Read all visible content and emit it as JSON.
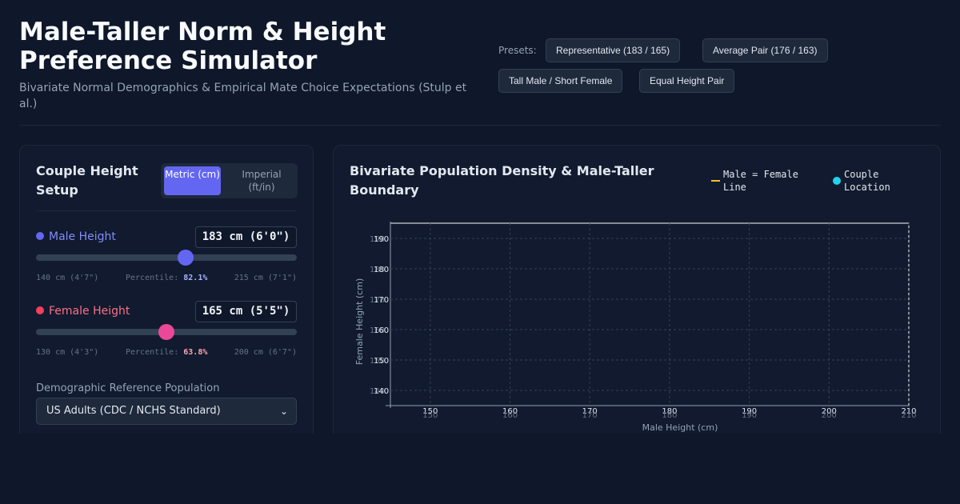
{
  "header": {
    "title": "Male-Taller Norm & Height Preference Simulator",
    "subtitle": "Bivariate Normal Demographics & Empirical Mate Choice Expectations (Stulp et al.)"
  },
  "presets": {
    "label": "Presets:",
    "items": [
      {
        "label": "Representative (183 / 165)"
      },
      {
        "label": "Average Pair (176 / 163)"
      },
      {
        "label": "Tall Male / Short Female"
      },
      {
        "label": "Equal Height Pair"
      }
    ]
  },
  "setup": {
    "title": "Couple Height Setup",
    "units": {
      "metric": "Metric (cm)",
      "imperial": "Imperial (ft/in)",
      "selected": "metric"
    },
    "male": {
      "label": "Male Height",
      "value_text": "183 cm (6'0\")",
      "value_cm": 183,
      "min_cm": 140,
      "max_cm": 215,
      "min_label": "140 cm (4'7\")",
      "max_label": "215 cm (7'1\")",
      "percentile_label": "Percentile:",
      "percentile": "82.1%"
    },
    "female": {
      "label": "Female Height",
      "value_text": "165 cm (5'5\")",
      "value_cm": 165,
      "min_cm": 130,
      "max_cm": 200,
      "min_label": "130 cm (4'3\")",
      "max_label": "200 cm (6'7\")",
      "percentile_label": "Percentile:",
      "percentile": "63.8%"
    },
    "population": {
      "label": "Demographic Reference Population",
      "selected": "US Adults (CDC / NCHS Standard)"
    }
  },
  "chart_panel": {
    "title": "Bivariate Population Density & Male-Taller Boundary",
    "legend": {
      "line": "Male = Female Line",
      "point": "Couple Location"
    }
  },
  "chart_data": {
    "type": "scatter",
    "title": "",
    "xlabel": "Male Height (cm)",
    "ylabel": "Female Height (cm)",
    "x_ticks": [
      150,
      160,
      170,
      180,
      190,
      200,
      210
    ],
    "y_ticks": [
      140,
      150,
      160,
      170,
      180,
      190
    ],
    "xlim": [
      145,
      210
    ],
    "ylim": [
      135,
      195
    ],
    "grid": true,
    "series": []
  },
  "colors": {
    "male": "#6366f1",
    "female": "#ec4899",
    "equal_line": "#fbbf24",
    "couple_point": "#22d3ee"
  }
}
